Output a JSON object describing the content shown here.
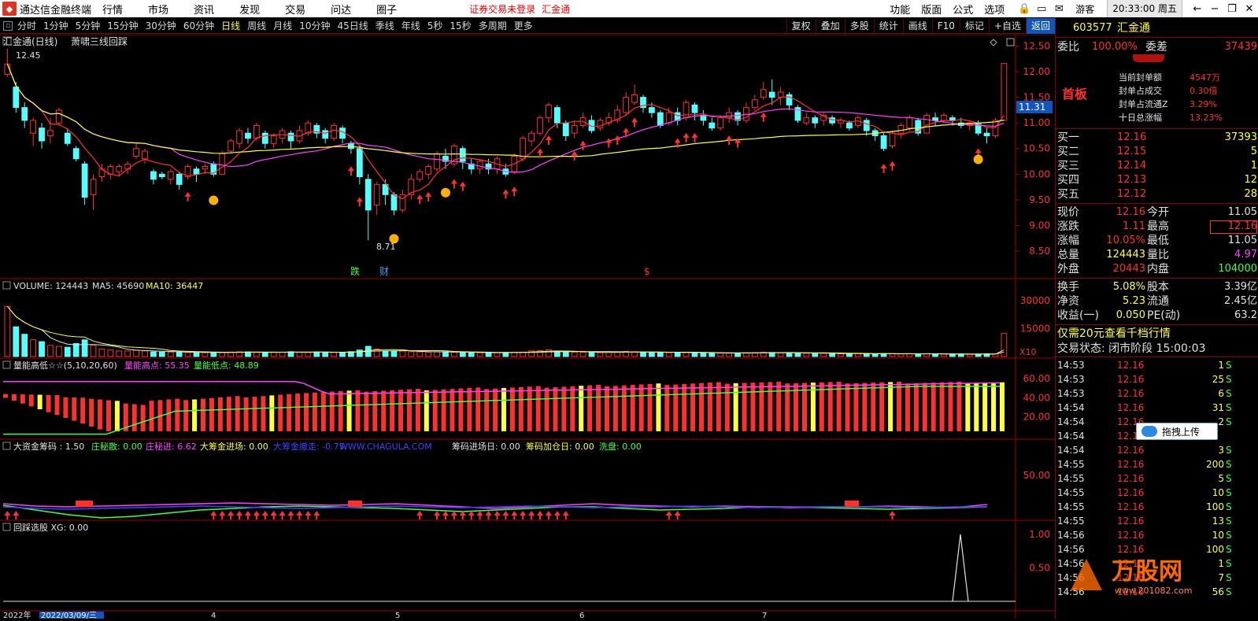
{
  "titlebar": {
    "app_name": "通达信金融终端",
    "menus": [
      "行情",
      "市场",
      "资讯",
      "发现",
      "交易",
      "问达",
      "圈子"
    ],
    "warning": "证券交易未登录",
    "stock_name": "汇金通",
    "right_menus": [
      "功能",
      "版面",
      "公式",
      "选项"
    ],
    "guest": "游客",
    "clock": "20:33:00 周五"
  },
  "periodbar": {
    "periods": [
      "分时",
      "1分钟",
      "5分钟",
      "15分钟",
      "30分钟",
      "60分钟",
      "日线",
      "周线",
      "月线",
      "10分钟",
      "45日线",
      "季线",
      "年线",
      "5秒",
      "15秒",
      "多周期",
      "更多"
    ],
    "active": "日线",
    "tools": [
      "复权",
      "叠加",
      "多股",
      "统计",
      "画线",
      "F10",
      "标记",
      "+自选",
      "返回"
    ]
  },
  "main_chart": {
    "title": "汇金通(日线)",
    "indicator": "萧啸三线回踩",
    "high_label": "12.45",
    "low_label": "8.71",
    "current_price_tag": "11.31",
    "yticks": [
      "12.50",
      "12.00",
      "11.50",
      "11.00",
      "10.50",
      "10.00",
      "9.50",
      "9.00",
      "8.50"
    ],
    "events": [
      "跌",
      "财",
      "$"
    ]
  },
  "volume_panel": {
    "label": "VOLUME: 124443",
    "ma5": "MA5: 45690",
    "ma10": "MA10: 36447",
    "yticks": [
      "30000",
      "15000"
    ],
    "unit": "X10"
  },
  "energy_panel": {
    "label": "量能高低☆☆(5,10,20,60)",
    "high": "量能高点: 55.35",
    "low": "量能低点: 48.89",
    "yticks": [
      "60.00",
      "40.00",
      "20.00"
    ]
  },
  "capital_panel": {
    "items": [
      {
        "text": "大资金筹码 : 1.50",
        "color": "#e0e0e0"
      },
      {
        "text": "庄秘散: 0.00",
        "color": "#40ff40"
      },
      {
        "text": "庄秘进: 6.62",
        "color": "#ff40ff"
      },
      {
        "text": "大筹金进场: 0.00",
        "color": "#ffff40"
      },
      {
        "text": "大筹金撤走: -0.75",
        "color": "#4040ff"
      },
      {
        "text": "WWW.CHAGULA.COM",
        "color": "#4040ff"
      },
      {
        "text": "筹码进场日: 0.00",
        "color": "#e0e0e0"
      },
      {
        "text": "筹码加仓日: 0.00",
        "color": "#ffff40"
      },
      {
        "text": "洗盘: 0.00",
        "color": "#40ff40"
      }
    ],
    "ytick": "50.00"
  },
  "select_panel": {
    "label": "回踩选股 XG: 0.00",
    "yticks": [
      "1.00",
      "0.50"
    ]
  },
  "bottom_axis": {
    "labels": [
      "2022年",
      "2022/03/09/三",
      "4",
      "5",
      "6",
      "7"
    ]
  },
  "quote": {
    "code": "603577",
    "name": "汇金通",
    "weibi_label": "委比",
    "weibi": "100.00%",
    "weicha_label": "委差",
    "weicha": "37439",
    "board": "首板",
    "seal_items": [
      {
        "label": "当前封单额",
        "value": "4547万"
      },
      {
        "label": "封单占成交",
        "value": "0.30倍"
      },
      {
        "label": "封单占流通Z",
        "value": "3.29%"
      },
      {
        "label": "十日总涨幅",
        "value": "13.23%"
      }
    ],
    "bids": [
      {
        "label": "买一",
        "price": "12.16",
        "vol": "37393"
      },
      {
        "label": "买二",
        "price": "12.15",
        "vol": "5"
      },
      {
        "label": "买三",
        "price": "12.14",
        "vol": "1"
      },
      {
        "label": "买四",
        "price": "12.13",
        "vol": "12"
      },
      {
        "label": "买五",
        "price": "12.12",
        "vol": "28"
      }
    ],
    "stats": [
      {
        "l1": "现价",
        "v1": "12.16",
        "l2": "今开",
        "v2": "11.05",
        "c1": "#ff3030",
        "c2": "#e0e0e0"
      },
      {
        "l1": "涨跌",
        "v1": "1.11",
        "l2": "最高",
        "v2": "12.16",
        "c1": "#ff3030",
        "c2": "#ff3030"
      },
      {
        "l1": "涨幅",
        "v1": "10.05%",
        "l2": "最低",
        "v2": "11.05",
        "c1": "#ff3030",
        "c2": "#e0e0e0"
      },
      {
        "l1": "总量",
        "v1": "124443",
        "l2": "量比",
        "v2": "4.97",
        "c1": "#ffff40",
        "c2": "#ff40ff"
      },
      {
        "l1": "外盘",
        "v1": "20443",
        "l2": "内盘",
        "v2": "104000",
        "c1": "#ff3030",
        "c2": "#40ff40"
      }
    ],
    "stats2": [
      {
        "l1": "换手",
        "v1": "5.08%",
        "l2": "股本",
        "v2": "3.39亿"
      },
      {
        "l1": "净资",
        "v1": "5.23",
        "l2": "流通",
        "v2": "2.45亿"
      },
      {
        "l1": "收益(一)",
        "v1": "0.050",
        "l2": "PE(动)",
        "v2": "63.2"
      }
    ],
    "promo": "仅需20元查看千档行情",
    "status": "交易状态: 闭市阶段 15:00:03",
    "ticks": [
      {
        "t": "14:53",
        "p": "12.16",
        "v": "1",
        "s": "S"
      },
      {
        "t": "14:53",
        "p": "12.16",
        "v": "25",
        "s": "S"
      },
      {
        "t": "14:53",
        "p": "12.16",
        "v": "6",
        "s": "S"
      },
      {
        "t": "14:54",
        "p": "12.16",
        "v": "31",
        "s": "S"
      },
      {
        "t": "14:54",
        "p": "12.16",
        "v": "2",
        "s": "S"
      },
      {
        "t": "14:54",
        "p": "12.16",
        "v": "",
        "s": ""
      },
      {
        "t": "14:54",
        "p": "12.16",
        "v": "3",
        "s": "S"
      },
      {
        "t": "14:55",
        "p": "12.16",
        "v": "200",
        "s": "S"
      },
      {
        "t": "14:55",
        "p": "12.16",
        "v": "5",
        "s": "S"
      },
      {
        "t": "14:55",
        "p": "12.16",
        "v": "10",
        "s": "S"
      },
      {
        "t": "14:55",
        "p": "12.16",
        "v": "100",
        "s": "S"
      },
      {
        "t": "14:55",
        "p": "12.16",
        "v": "13",
        "s": "S"
      },
      {
        "t": "14:56",
        "p": "12.16",
        "v": "10",
        "s": "S"
      },
      {
        "t": "14:56",
        "p": "12.16",
        "v": "100",
        "s": "S"
      },
      {
        "t": "14:56",
        "p": "12.16",
        "v": "1",
        "s": "S"
      },
      {
        "t": "14:56",
        "p": "12.16",
        "v": "7",
        "s": "S"
      },
      {
        "t": "14:56",
        "p": "12.16",
        "v": "56",
        "s": "S"
      }
    ]
  },
  "upload_button": "拖拽上传",
  "watermark": {
    "text": "万股网",
    "sub": "www.201082.com"
  },
  "colors": {
    "up": "#ff3030",
    "down": "#54ffff",
    "ma_short": "#ff3030",
    "ma_mid": "#ff40ff",
    "ma_long": "#ffff40",
    "grid": "#800000"
  },
  "chart_data": {
    "type": "candlestick",
    "candles": [
      [
        11.95,
        12.15,
        11.9,
        12.45
      ],
      [
        11.7,
        11.3,
        11.2,
        11.8
      ],
      [
        11.3,
        11.05,
        10.9,
        11.4
      ],
      [
        10.8,
        11.05,
        10.55,
        11.1
      ],
      [
        10.9,
        10.65,
        10.5,
        11.0
      ],
      [
        10.75,
        10.85,
        10.6,
        11.1
      ],
      [
        11.0,
        11.25,
        10.95,
        11.3
      ],
      [
        10.8,
        10.6,
        10.55,
        10.9
      ],
      [
        10.5,
        10.3,
        10.25,
        10.55
      ],
      [
        10.2,
        9.55,
        9.4,
        10.25
      ],
      [
        9.6,
        9.9,
        9.3,
        10.0
      ],
      [
        9.95,
        10.1,
        9.85,
        10.2
      ],
      [
        10.0,
        10.15,
        9.9,
        10.2
      ],
      [
        10.05,
        10.15,
        9.95,
        10.2
      ],
      [
        10.1,
        10.2,
        10.0,
        10.25
      ],
      [
        10.35,
        10.5,
        10.3,
        10.6
      ],
      [
        10.3,
        10.45,
        10.2,
        10.5
      ],
      [
        10.05,
        9.9,
        9.8,
        10.1
      ],
      [
        10.0,
        9.95,
        9.9,
        10.05
      ],
      [
        9.9,
        10.05,
        9.8,
        10.1
      ],
      [
        10.0,
        9.8,
        9.7,
        10.05
      ],
      [
        9.95,
        10.15,
        9.9,
        10.2
      ],
      [
        10.1,
        10.0,
        9.85,
        10.15
      ],
      [
        10.1,
        10.15,
        10.0,
        10.2
      ],
      [
        10.2,
        10.0,
        9.95,
        10.25
      ],
      [
        10.0,
        10.4,
        10.0,
        10.45
      ],
      [
        10.45,
        10.65,
        10.4,
        10.7
      ],
      [
        10.6,
        10.85,
        10.5,
        10.9
      ],
      [
        10.8,
        10.7,
        10.6,
        10.9
      ],
      [
        10.7,
        10.95,
        10.65,
        11.0
      ],
      [
        10.8,
        10.6,
        10.5,
        10.85
      ],
      [
        10.6,
        10.75,
        10.5,
        10.8
      ],
      [
        10.7,
        10.85,
        10.6,
        10.9
      ],
      [
        10.8,
        10.65,
        10.5,
        10.85
      ],
      [
        10.65,
        10.85,
        10.6,
        10.95
      ],
      [
        10.8,
        11.0,
        10.75,
        11.05
      ],
      [
        10.95,
        10.8,
        10.7,
        11.0
      ],
      [
        10.85,
        10.7,
        10.6,
        10.9
      ],
      [
        10.7,
        10.95,
        10.65,
        11.0
      ],
      [
        10.9,
        10.7,
        10.6,
        10.95
      ],
      [
        10.6,
        10.5,
        10.4,
        10.65
      ],
      [
        10.5,
        9.95,
        9.8,
        10.55
      ],
      [
        9.9,
        9.3,
        8.71,
        10.0
      ],
      [
        9.4,
        9.8,
        9.2,
        9.85
      ],
      [
        9.8,
        9.6,
        9.4,
        9.9
      ],
      [
        9.6,
        9.3,
        9.2,
        9.65
      ],
      [
        9.3,
        9.6,
        9.25,
        9.7
      ],
      [
        9.6,
        9.9,
        9.5,
        10.0
      ],
      [
        9.9,
        10.05,
        9.85,
        10.1
      ],
      [
        10.0,
        10.15,
        9.9,
        10.2
      ],
      [
        10.1,
        10.4,
        10.05,
        10.45
      ],
      [
        10.35,
        10.25,
        10.1,
        10.5
      ],
      [
        10.2,
        10.55,
        10.15,
        10.6
      ],
      [
        10.5,
        10.25,
        10.1,
        10.55
      ],
      [
        10.2,
        10.1,
        10.0,
        10.3
      ],
      [
        10.1,
        10.25,
        10.0,
        10.3
      ],
      [
        10.2,
        10.1,
        10.0,
        10.3
      ],
      [
        10.1,
        10.3,
        10.0,
        10.35
      ],
      [
        10.1,
        10.0,
        9.95,
        10.2
      ],
      [
        10.05,
        10.35,
        10.0,
        10.4
      ],
      [
        10.3,
        10.7,
        10.25,
        10.75
      ],
      [
        10.65,
        10.8,
        10.55,
        10.85
      ],
      [
        10.8,
        11.1,
        10.75,
        11.15
      ],
      [
        11.1,
        11.35,
        11.0,
        11.4
      ],
      [
        11.3,
        11.0,
        10.9,
        11.35
      ],
      [
        11.0,
        10.75,
        10.65,
        11.05
      ],
      [
        10.8,
        10.95,
        10.7,
        11.05
      ],
      [
        10.95,
        11.1,
        10.9,
        11.2
      ],
      [
        11.05,
        10.85,
        10.8,
        11.15
      ],
      [
        10.9,
        11.05,
        10.85,
        11.1
      ],
      [
        11.0,
        11.1,
        10.95,
        11.2
      ],
      [
        11.05,
        11.25,
        11.0,
        11.35
      ],
      [
        11.2,
        11.5,
        11.15,
        11.6
      ],
      [
        11.4,
        11.55,
        11.35,
        11.75
      ],
      [
        11.5,
        11.3,
        11.2,
        11.55
      ],
      [
        11.3,
        11.2,
        11.1,
        11.4
      ],
      [
        11.2,
        10.95,
        10.9,
        11.25
      ],
      [
        11.0,
        11.2,
        10.95,
        11.3
      ],
      [
        11.2,
        11.05,
        10.95,
        11.3
      ],
      [
        11.1,
        11.4,
        11.05,
        11.45
      ],
      [
        11.35,
        11.2,
        11.05,
        11.4
      ],
      [
        11.15,
        11.05,
        10.95,
        11.25
      ],
      [
        11.0,
        10.9,
        10.85,
        11.1
      ],
      [
        10.9,
        11.1,
        10.85,
        11.15
      ],
      [
        11.1,
        11.2,
        11.0,
        11.3
      ],
      [
        11.2,
        11.05,
        10.95,
        11.25
      ],
      [
        11.05,
        11.3,
        11.0,
        11.4
      ],
      [
        11.3,
        11.45,
        11.25,
        11.55
      ],
      [
        11.5,
        11.65,
        11.45,
        11.8
      ],
      [
        11.6,
        11.5,
        11.35,
        11.85
      ],
      [
        11.5,
        11.6,
        11.35,
        11.7
      ],
      [
        11.55,
        11.35,
        11.25,
        11.6
      ],
      [
        11.3,
        11.05,
        11.0,
        11.35
      ],
      [
        11.0,
        11.1,
        10.95,
        11.2
      ],
      [
        11.1,
        11.0,
        10.9,
        11.15
      ],
      [
        11.05,
        11.15,
        10.95,
        11.2
      ],
      [
        11.1,
        11.0,
        10.95,
        11.15
      ],
      [
        11.0,
        11.05,
        10.9,
        11.1
      ],
      [
        11.0,
        10.9,
        10.85,
        11.05
      ],
      [
        10.95,
        11.1,
        10.9,
        11.15
      ],
      [
        11.05,
        10.85,
        10.75,
        11.1
      ],
      [
        10.85,
        10.75,
        10.65,
        10.9
      ],
      [
        10.75,
        10.5,
        10.45,
        10.8
      ],
      [
        10.55,
        10.8,
        10.5,
        10.85
      ],
      [
        10.8,
        10.95,
        10.7,
        11.0
      ],
      [
        10.9,
        11.1,
        10.85,
        11.15
      ],
      [
        11.05,
        10.8,
        10.75,
        11.1
      ],
      [
        10.8,
        11.15,
        10.8,
        11.2
      ],
      [
        11.1,
        11.05,
        10.95,
        11.2
      ],
      [
        11.05,
        11.15,
        11.0,
        11.2
      ],
      [
        11.1,
        11.05,
        10.95,
        11.15
      ],
      [
        11.0,
        10.95,
        10.9,
        11.1
      ],
      [
        10.95,
        11.0,
        10.85,
        11.05
      ],
      [
        11.0,
        10.8,
        10.75,
        11.05
      ],
      [
        10.8,
        10.75,
        10.6,
        10.9
      ],
      [
        10.75,
        11.05,
        10.7,
        11.1
      ],
      [
        11.05,
        12.16,
        11.05,
        12.16
      ]
    ],
    "ylim": [
      8.3,
      12.6
    ],
    "volume": [
      27000,
      16000,
      12000,
      9000,
      8000,
      6000,
      5500,
      5000,
      7000,
      9000,
      6000,
      4000,
      3500,
      3000,
      3000,
      3500,
      3000,
      2500,
      2400,
      2300,
      2500,
      2200,
      2000,
      2100,
      2200,
      2300,
      2400,
      2600,
      2500,
      2300,
      2200,
      2300,
      2400,
      2600,
      2300,
      2200,
      2500,
      2400,
      2200,
      2300,
      2600,
      3500,
      5500,
      4000,
      3000,
      2800,
      3000,
      2600,
      2500,
      2300,
      2500,
      2600,
      2300,
      2200,
      2000,
      2100,
      2000,
      2100,
      2200,
      2300,
      2400,
      3000,
      3200,
      3600,
      2800,
      2300,
      2400,
      2300,
      2200,
      2100,
      2300,
      2500,
      2800,
      2600,
      2400,
      2300,
      2200,
      2100,
      2000,
      2300,
      2000,
      1900,
      1800,
      1900,
      2000,
      1900,
      2000,
      2100,
      2300,
      2200,
      2000,
      2100,
      2000,
      1800,
      1700,
      1700,
      1600,
      1500,
      1500,
      1600,
      1500,
      1400,
      1600,
      1500,
      1400,
      1500,
      1400,
      1500,
      1400,
      1300,
      1300,
      1200,
      1200,
      1300,
      1500,
      1400,
      12444
    ],
    "volume_ylim": [
      0,
      36000
    ]
  }
}
